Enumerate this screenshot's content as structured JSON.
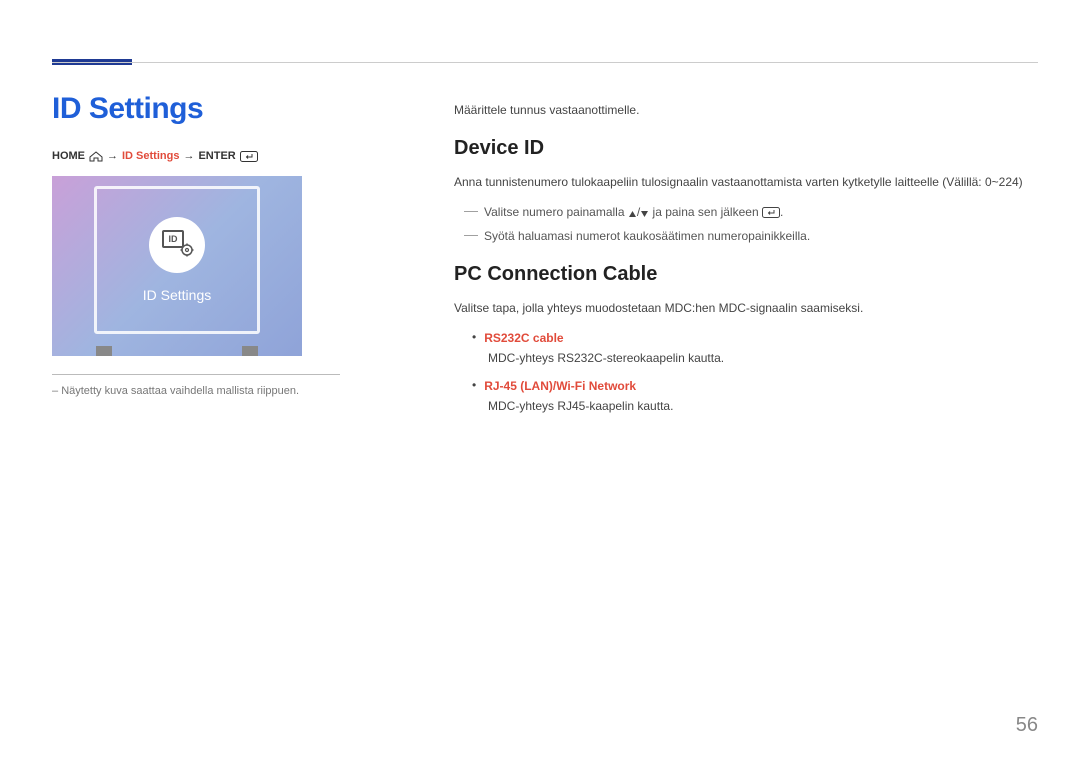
{
  "page": {
    "number": "56"
  },
  "left": {
    "heading": "ID Settings",
    "breadcrumb": {
      "home": "HOME",
      "id_settings": "ID Settings",
      "enter": "ENTER"
    },
    "screenshot": {
      "icon_text": "ID",
      "label": "ID Settings"
    },
    "note": "Näytetty kuva saattaa vaihdella mallista riippuen."
  },
  "right": {
    "intro": "Määrittele tunnus vastaanottimelle.",
    "device_id": {
      "heading": "Device ID",
      "desc": "Anna tunnistenumero tulokaapeliin tulosignaalin vastaanottamista varten kytketylle laitteelle (Välillä: 0~224)",
      "line1_a": "Valitse numero painamalla ",
      "line1_b": " ja paina sen jälkeen ",
      "line1_c": ".",
      "line2": "Syötä haluamasi numerot kaukosäätimen numeropainikkeilla."
    },
    "pc_cable": {
      "heading": "PC Connection Cable",
      "desc": "Valitse tapa, jolla yhteys muodostetaan MDC:hen MDC-signaalin saamiseksi.",
      "items": [
        {
          "title": "RS232C cable",
          "desc": "MDC-yhteys RS232C-stereokaapelin kautta."
        },
        {
          "title": "RJ-45 (LAN)/Wi-Fi Network",
          "desc": "MDC-yhteys RJ45-kaapelin kautta."
        }
      ]
    }
  }
}
